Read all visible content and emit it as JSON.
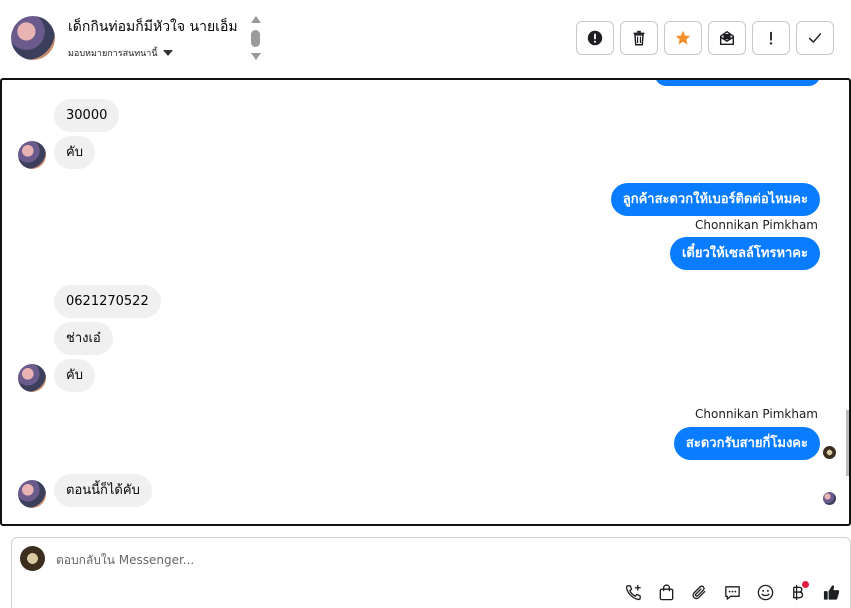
{
  "header": {
    "contact_name": "เด็กกินท่อมก็มีหัวใจ นายเอ็ม",
    "assign_label": "มอบหมายการสนทนานี้",
    "actions": [
      {
        "name": "mark-spam-button",
        "icon": "exclamation-circle-icon"
      },
      {
        "name": "delete-button",
        "icon": "trash-icon"
      },
      {
        "name": "star-button",
        "icon": "star-icon",
        "color": "#f5922f"
      },
      {
        "name": "mark-unread-button",
        "icon": "envelope-icon"
      },
      {
        "name": "follow-up-button",
        "icon": "exclamation-icon"
      },
      {
        "name": "mark-done-button",
        "icon": "check-icon"
      }
    ]
  },
  "messages": {
    "m1": "30000",
    "m2": "คับ",
    "m3": "ลูกค้าสะดวกให้เบอร์ติดต่อไหมคะ",
    "sender1": "Chonnikan Pimkham",
    "m4": "เดี๋ยวให้เซลล์โทรหาคะ",
    "m5": "0621270522",
    "m6": "ช่างเอ๋",
    "m7": "คับ",
    "sender2": "Chonnikan Pimkham",
    "m8": "สะดวกรับสายกี่โมงคะ",
    "m9": "ตอนนี้ก็ได้คับ"
  },
  "composer": {
    "placeholder": "ตอบกลับใน Messenger...",
    "tools": [
      "phone-plus-icon",
      "shopping-bag-icon",
      "paperclip-icon",
      "saved-reply-icon",
      "emoji-icon",
      "baht-payment-icon",
      "thumbs-up-icon"
    ]
  },
  "colors": {
    "outgoing_bubble": "#0a7cff",
    "incoming_bubble": "#f0f0f0",
    "star": "#f5922f",
    "notification": "#e41e3f"
  }
}
